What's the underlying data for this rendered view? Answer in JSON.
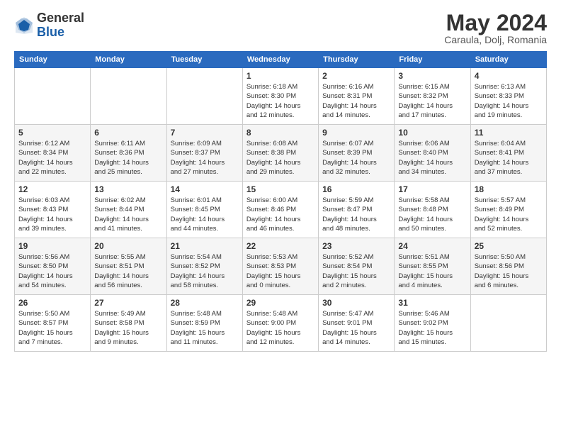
{
  "header": {
    "logo_line1": "General",
    "logo_line2": "Blue",
    "month_title": "May 2024",
    "location": "Caraula, Dolj, Romania"
  },
  "weekdays": [
    "Sunday",
    "Monday",
    "Tuesday",
    "Wednesday",
    "Thursday",
    "Friday",
    "Saturday"
  ],
  "weeks": [
    [
      {
        "day": "",
        "info": ""
      },
      {
        "day": "",
        "info": ""
      },
      {
        "day": "",
        "info": ""
      },
      {
        "day": "1",
        "info": "Sunrise: 6:18 AM\nSunset: 8:30 PM\nDaylight: 14 hours\nand 12 minutes."
      },
      {
        "day": "2",
        "info": "Sunrise: 6:16 AM\nSunset: 8:31 PM\nDaylight: 14 hours\nand 14 minutes."
      },
      {
        "day": "3",
        "info": "Sunrise: 6:15 AM\nSunset: 8:32 PM\nDaylight: 14 hours\nand 17 minutes."
      },
      {
        "day": "4",
        "info": "Sunrise: 6:13 AM\nSunset: 8:33 PM\nDaylight: 14 hours\nand 19 minutes."
      }
    ],
    [
      {
        "day": "5",
        "info": "Sunrise: 6:12 AM\nSunset: 8:34 PM\nDaylight: 14 hours\nand 22 minutes."
      },
      {
        "day": "6",
        "info": "Sunrise: 6:11 AM\nSunset: 8:36 PM\nDaylight: 14 hours\nand 25 minutes."
      },
      {
        "day": "7",
        "info": "Sunrise: 6:09 AM\nSunset: 8:37 PM\nDaylight: 14 hours\nand 27 minutes."
      },
      {
        "day": "8",
        "info": "Sunrise: 6:08 AM\nSunset: 8:38 PM\nDaylight: 14 hours\nand 29 minutes."
      },
      {
        "day": "9",
        "info": "Sunrise: 6:07 AM\nSunset: 8:39 PM\nDaylight: 14 hours\nand 32 minutes."
      },
      {
        "day": "10",
        "info": "Sunrise: 6:06 AM\nSunset: 8:40 PM\nDaylight: 14 hours\nand 34 minutes."
      },
      {
        "day": "11",
        "info": "Sunrise: 6:04 AM\nSunset: 8:41 PM\nDaylight: 14 hours\nand 37 minutes."
      }
    ],
    [
      {
        "day": "12",
        "info": "Sunrise: 6:03 AM\nSunset: 8:43 PM\nDaylight: 14 hours\nand 39 minutes."
      },
      {
        "day": "13",
        "info": "Sunrise: 6:02 AM\nSunset: 8:44 PM\nDaylight: 14 hours\nand 41 minutes."
      },
      {
        "day": "14",
        "info": "Sunrise: 6:01 AM\nSunset: 8:45 PM\nDaylight: 14 hours\nand 44 minutes."
      },
      {
        "day": "15",
        "info": "Sunrise: 6:00 AM\nSunset: 8:46 PM\nDaylight: 14 hours\nand 46 minutes."
      },
      {
        "day": "16",
        "info": "Sunrise: 5:59 AM\nSunset: 8:47 PM\nDaylight: 14 hours\nand 48 minutes."
      },
      {
        "day": "17",
        "info": "Sunrise: 5:58 AM\nSunset: 8:48 PM\nDaylight: 14 hours\nand 50 minutes."
      },
      {
        "day": "18",
        "info": "Sunrise: 5:57 AM\nSunset: 8:49 PM\nDaylight: 14 hours\nand 52 minutes."
      }
    ],
    [
      {
        "day": "19",
        "info": "Sunrise: 5:56 AM\nSunset: 8:50 PM\nDaylight: 14 hours\nand 54 minutes."
      },
      {
        "day": "20",
        "info": "Sunrise: 5:55 AM\nSunset: 8:51 PM\nDaylight: 14 hours\nand 56 minutes."
      },
      {
        "day": "21",
        "info": "Sunrise: 5:54 AM\nSunset: 8:52 PM\nDaylight: 14 hours\nand 58 minutes."
      },
      {
        "day": "22",
        "info": "Sunrise: 5:53 AM\nSunset: 8:53 PM\nDaylight: 15 hours\nand 0 minutes."
      },
      {
        "day": "23",
        "info": "Sunrise: 5:52 AM\nSunset: 8:54 PM\nDaylight: 15 hours\nand 2 minutes."
      },
      {
        "day": "24",
        "info": "Sunrise: 5:51 AM\nSunset: 8:55 PM\nDaylight: 15 hours\nand 4 minutes."
      },
      {
        "day": "25",
        "info": "Sunrise: 5:50 AM\nSunset: 8:56 PM\nDaylight: 15 hours\nand 6 minutes."
      }
    ],
    [
      {
        "day": "26",
        "info": "Sunrise: 5:50 AM\nSunset: 8:57 PM\nDaylight: 15 hours\nand 7 minutes."
      },
      {
        "day": "27",
        "info": "Sunrise: 5:49 AM\nSunset: 8:58 PM\nDaylight: 15 hours\nand 9 minutes."
      },
      {
        "day": "28",
        "info": "Sunrise: 5:48 AM\nSunset: 8:59 PM\nDaylight: 15 hours\nand 11 minutes."
      },
      {
        "day": "29",
        "info": "Sunrise: 5:48 AM\nSunset: 9:00 PM\nDaylight: 15 hours\nand 12 minutes."
      },
      {
        "day": "30",
        "info": "Sunrise: 5:47 AM\nSunset: 9:01 PM\nDaylight: 15 hours\nand 14 minutes."
      },
      {
        "day": "31",
        "info": "Sunrise: 5:46 AM\nSunset: 9:02 PM\nDaylight: 15 hours\nand 15 minutes."
      },
      {
        "day": "",
        "info": ""
      }
    ]
  ]
}
